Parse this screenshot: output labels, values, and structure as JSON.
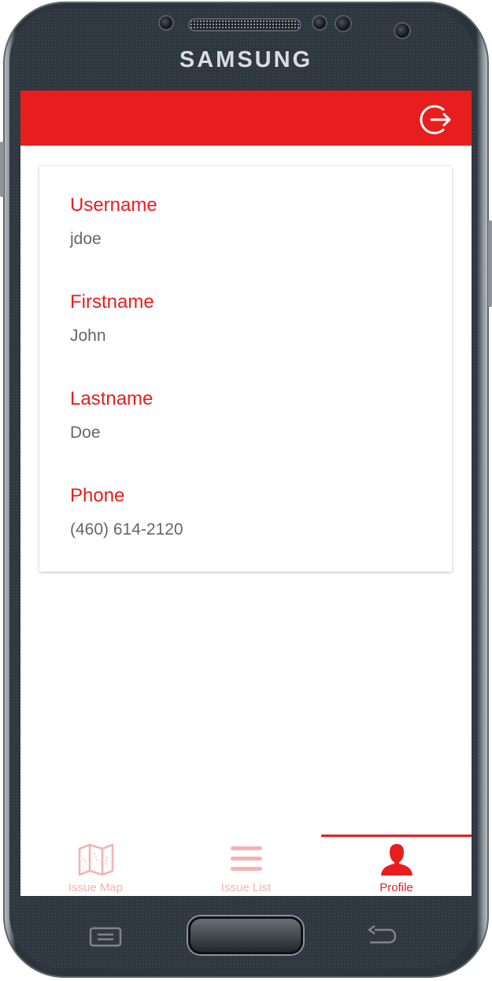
{
  "device": {
    "brand": "SAMSUNG"
  },
  "appbar": {
    "logout_icon": "logout-icon",
    "color": "#e81e1e"
  },
  "profile": {
    "fields": [
      {
        "label": "Username",
        "value": "jdoe"
      },
      {
        "label": "Firstname",
        "value": "John"
      },
      {
        "label": "Lastname",
        "value": "Doe"
      },
      {
        "label": "Phone",
        "value": "(460) 614-2120"
      }
    ]
  },
  "bottom_nav": {
    "tabs": [
      {
        "label": "Issue Map",
        "icon": "map-icon",
        "active": false
      },
      {
        "label": "Issue List",
        "icon": "list-icon",
        "active": false
      },
      {
        "label": "Profile",
        "icon": "person-icon",
        "active": true
      }
    ],
    "active_color": "#e81e1e",
    "inactive_color": "#f4b3b3"
  }
}
